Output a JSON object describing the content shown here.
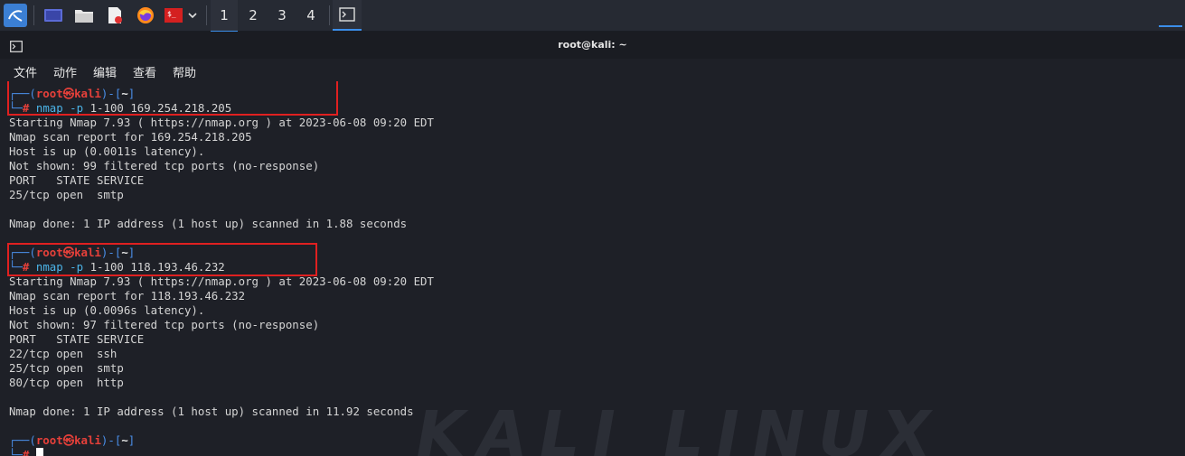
{
  "window": {
    "title": "root@kali: ~"
  },
  "taskbar": {
    "workspaces": [
      "1",
      "2",
      "3",
      "4"
    ],
    "icons": [
      "kali-menu-icon",
      "desktop-icon",
      "file-manager-icon",
      "text-editor-icon",
      "firefox-icon",
      "terminal-launcher-icon",
      "chevron-down-icon",
      "terminal-task-icon"
    ]
  },
  "menu": [
    "文件",
    "动作",
    "编辑",
    "查看",
    "帮助"
  ],
  "prompt": {
    "user": "root",
    "at": "㉿",
    "host": "kali",
    "dir": "~",
    "symbol": "#"
  },
  "sessions": [
    {
      "command": "nmap",
      "flag": "-p",
      "args": "1-100 169.254.218.205",
      "output": [
        "Starting Nmap 7.93 ( https://nmap.org ) at 2023-06-08 09:20 EDT",
        "Nmap scan report for 169.254.218.205",
        "Host is up (0.0011s latency).",
        "Not shown: 99 filtered tcp ports (no-response)",
        "PORT   STATE SERVICE",
        "25/tcp open  smtp",
        "",
        "Nmap done: 1 IP address (1 host up) scanned in 1.88 seconds"
      ]
    },
    {
      "command": "nmap",
      "flag": "-p",
      "args": "1-100 118.193.46.232",
      "output": [
        "Starting Nmap 7.93 ( https://nmap.org ) at 2023-06-08 09:20 EDT",
        "Nmap scan report for 118.193.46.232",
        "Host is up (0.0096s latency).",
        "Not shown: 97 filtered tcp ports (no-response)",
        "PORT   STATE SERVICE",
        "22/tcp open  ssh",
        "25/tcp open  smtp",
        "80/tcp open  http",
        "",
        "Nmap done: 1 IP address (1 host up) scanned in 11.92 seconds"
      ]
    }
  ],
  "watermark": "KALI LINUX",
  "colors": {
    "highlight_box": "#e02020",
    "prompt_blue": "#4a8ee8",
    "prompt_red": "#e6403a",
    "command": "#4bb4e8"
  }
}
